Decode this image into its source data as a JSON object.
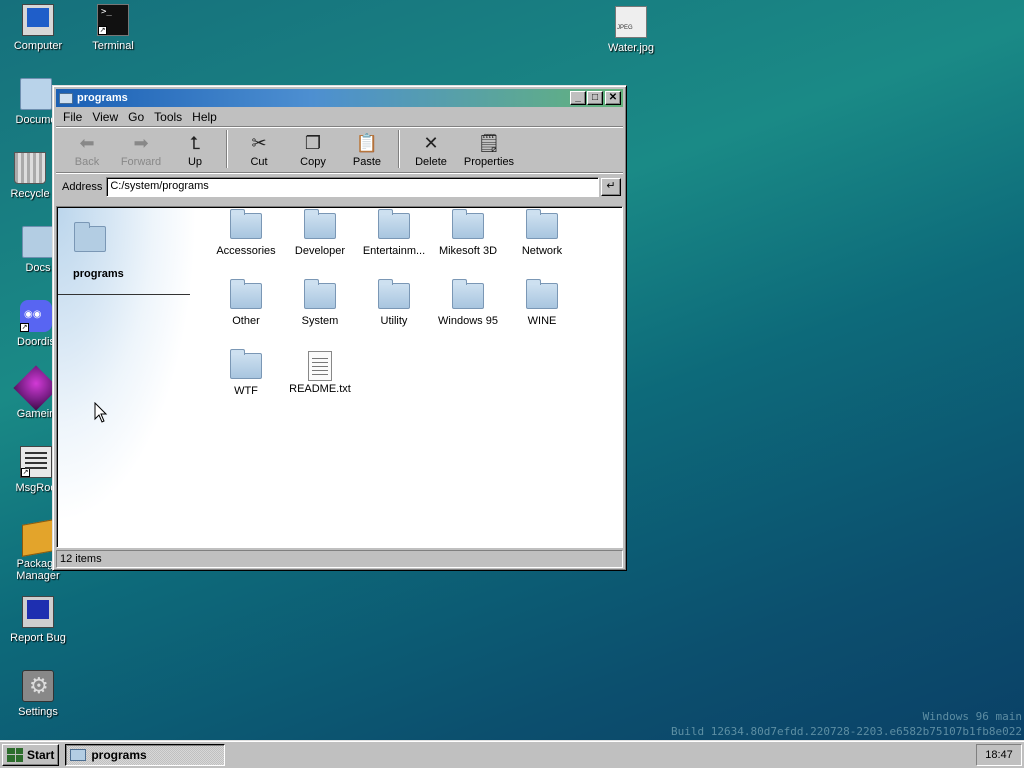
{
  "desktop": {
    "icons": [
      {
        "label": "Computer"
      },
      {
        "label": "Terminal"
      },
      {
        "label": "Docume"
      },
      {
        "label": "Recycle"
      },
      {
        "label": "Docs"
      },
      {
        "label": "Doordis"
      },
      {
        "label": "Gamein"
      },
      {
        "label": "MsgRoo"
      },
      {
        "label": "Package Manager"
      },
      {
        "label": "Report Bug"
      },
      {
        "label": "Settings"
      },
      {
        "label": "Water.jpg"
      }
    ]
  },
  "window": {
    "title": "programs",
    "menu": [
      "File",
      "View",
      "Go",
      "Tools",
      "Help"
    ],
    "toolbar": {
      "back": "Back",
      "forward": "Forward",
      "up": "Up",
      "cut": "Cut",
      "copy": "Copy",
      "paste": "Paste",
      "delete": "Delete",
      "properties": "Properties"
    },
    "address": {
      "label": "Address",
      "value": "C:/system/programs",
      "go_glyph": "↵"
    },
    "sidebar": {
      "folder_name": "programs"
    },
    "items": [
      {
        "name": "Accessories",
        "type": "folder"
      },
      {
        "name": "Developer",
        "type": "folder"
      },
      {
        "name": "Entertainm...",
        "type": "folder"
      },
      {
        "name": "Mikesoft 3D",
        "type": "folder"
      },
      {
        "name": "Network",
        "type": "folder"
      },
      {
        "name": "Other",
        "type": "folder"
      },
      {
        "name": "System",
        "type": "folder"
      },
      {
        "name": "Utility",
        "type": "folder"
      },
      {
        "name": "Windows 95",
        "type": "folder"
      },
      {
        "name": "WINE",
        "type": "folder"
      },
      {
        "name": "WTF",
        "type": "folder"
      },
      {
        "name": "README.txt",
        "type": "text-file"
      }
    ],
    "status": "12 items"
  },
  "build": {
    "line1": "Windows 96 main",
    "line2": "Build 12634.80d7efdd.220728-2203.e6582b75107b1fb8e022"
  },
  "taskbar": {
    "start_label": "Start",
    "task_label": "programs",
    "clock": "18:47"
  }
}
